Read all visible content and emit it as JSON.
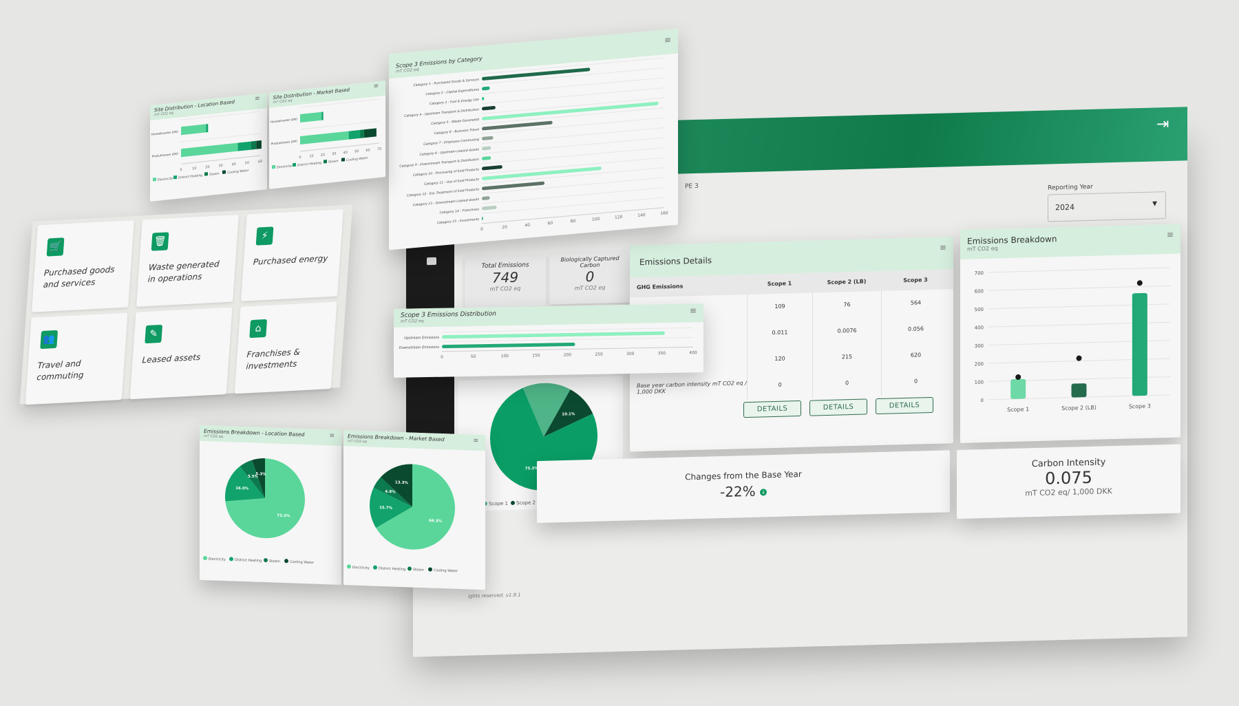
{
  "colors": {
    "accent": "#0e9a62",
    "light": "#5ad69b",
    "dark": "#1f6a4a",
    "header": "#d6eedd"
  },
  "header": {
    "exit_icon": "logout-icon",
    "tab_fragment": "PE 3"
  },
  "reporting_year": {
    "label": "Reporting Year",
    "value": "2024"
  },
  "kpis": {
    "total": {
      "label": "Total Emissions",
      "value": "749",
      "unit": "mT CO2 eq"
    },
    "bio": {
      "label": "Biologically Captured Carbon",
      "value": "0",
      "unit": "mT CO2 eq"
    }
  },
  "details": {
    "title": "Emissions Details",
    "row_header": "GHG Emissions",
    "columns": [
      "Scope 1",
      "Scope 2 (LB)",
      "Scope 3"
    ],
    "row_fragments": [
      "s",
      "",
      "sions",
      "Base year carbon intensity mT CO2 eq / 1,000 DKK"
    ],
    "rows": [
      [
        "109",
        "76",
        "564"
      ],
      [
        "0.011",
        "0.0076",
        "0.056"
      ],
      [
        "120",
        "215",
        "620"
      ],
      [
        "0",
        "0",
        "0"
      ]
    ],
    "button": "DETAILS"
  },
  "base_change": {
    "label": "Changes from the Base Year",
    "value": "-22%",
    "icon": "arrow-down-circle-icon"
  },
  "intensity": {
    "label": "Carbon Intensity",
    "value": "0.075",
    "unit": "mT CO2 eq/ 1,000 DKK"
  },
  "footer": "ights reserved. v1.9.1",
  "tiles": [
    {
      "label": "Purchased goods and services",
      "icon": "cart-icon",
      "glyph": "🛒"
    },
    {
      "label": "Waste generated in operations",
      "icon": "trash-icon",
      "glyph": "🗑"
    },
    {
      "label": "Purchased energy",
      "icon": "lightning-icon",
      "glyph": "⚡"
    },
    {
      "label": "Travel and commuting",
      "icon": "people-icon",
      "glyph": "👥"
    },
    {
      "label": "Leased assets",
      "icon": "edit-icon",
      "glyph": "✎"
    },
    {
      "label": "Franchises & investments",
      "icon": "buildings-icon",
      "glyph": "⌂"
    }
  ],
  "chart_data": [
    {
      "id": "breakdown",
      "type": "bar",
      "title": "Emissions Breakdown",
      "subtitle": "mT CO2 eq",
      "categories": [
        "Scope 1",
        "Scope 2 (LB)",
        "Scope 3"
      ],
      "values": [
        109,
        76,
        564
      ],
      "markers": [
        120,
        215,
        620
      ],
      "ylim": [
        0,
        700
      ],
      "yticks": [
        0,
        100,
        200,
        300,
        400,
        500,
        600,
        700
      ],
      "grid": true,
      "bar_colors": [
        "#6dd9a6",
        "#256b4d",
        "#23a878"
      ]
    },
    {
      "id": "scope3cat",
      "type": "bar",
      "orientation": "horizontal",
      "title": "Scope 3 Emissions by Category",
      "subtitle": "mT CO2 eq",
      "categories": [
        "Category 1 - Purchased Goods & Services",
        "Category 2 - Capital Expenditures",
        "Category 3 - Fuel & Energy Use",
        "Category 4 - Upstream Transport & Distribution",
        "Category 5 - Waste Generated",
        "Category 6 - Business Travel",
        "Category 7 - Employee Commuting",
        "Category 8 - Upstream Leased Assets",
        "Category 9 - Downstream Transport & Distribution",
        "Category 10 - Processing of Sold Products",
        "Category 11 - Use of Sold Products",
        "Category 12 - EoL Treatment of Sold Products",
        "Category 13 - Downstream Leased Assets",
        "Category 14 - Franchises",
        "Category 15 - Investments"
      ],
      "values": [
        95,
        7,
        2,
        12,
        155,
        62,
        10,
        8,
        8,
        18,
        105,
        55,
        7,
        13,
        1
      ],
      "xlim": [
        0,
        160
      ],
      "xticks": [
        0,
        20,
        40,
        60,
        80,
        100,
        120,
        140,
        160
      ],
      "bar_colors": [
        "#1f6a4a",
        "#23a878",
        "#3cc48a",
        "#173f2f",
        "#8ef0c0",
        "#5d7266",
        "#8fa396",
        "#b8cfc1",
        "#5ad69b",
        "#173f2f",
        "#8ef0c0",
        "#5d7266",
        "#8fa396",
        "#b8cfc1",
        "#23a878"
      ]
    },
    {
      "id": "scope3dist",
      "type": "bar",
      "orientation": "horizontal",
      "title": "Scope 3 Emissions Distribution",
      "subtitle": "mT CO2 eq",
      "categories": [
        "Upstream Emissions",
        "Downstream Emissions"
      ],
      "values": [
        355,
        212
      ],
      "xlim": [
        0,
        400
      ],
      "xticks": [
        0,
        50,
        100,
        150,
        200,
        250,
        300,
        350,
        400
      ],
      "bar_colors": [
        "#8ef0c0",
        "#23a878"
      ]
    },
    {
      "id": "siteloc",
      "type": "bar",
      "orientation": "horizontal",
      "stacked": true,
      "title": "Site Distribution - Location Based",
      "subtitle": "mT CO2 eq",
      "categories": [
        "Hovedkvarter (DK)",
        "Produktionen (DK)"
      ],
      "series": [
        {
          "name": "Electricity",
          "values": [
            19,
            43
          ]
        },
        {
          "name": "District Heating",
          "values": [
            1.5,
            10
          ]
        },
        {
          "name": "Steam",
          "values": [
            0,
            4
          ]
        },
        {
          "name": "Cooling Water",
          "values": [
            0,
            4
          ]
        }
      ],
      "xlim": [
        0,
        60
      ],
      "xticks": [
        0,
        10,
        20,
        30,
        40,
        50,
        60
      ]
    },
    {
      "id": "sitemkt",
      "type": "bar",
      "orientation": "horizontal",
      "stacked": true,
      "title": "Site Distribution - Market Based",
      "subtitle": "mT CO2 eq",
      "categories": [
        "Hovedkvarter (DK)",
        "Produktionen (DK)"
      ],
      "series": [
        {
          "name": "Electricity",
          "values": [
            19,
            43
          ]
        },
        {
          "name": "District Heating",
          "values": [
            1.5,
            10
          ]
        },
        {
          "name": "Steam",
          "values": [
            0,
            3.5
          ]
        },
        {
          "name": "Cooling Water",
          "values": [
            0,
            11
          ]
        }
      ],
      "xlim": [
        0,
        70
      ],
      "xticks": [
        0,
        10,
        20,
        30,
        40,
        50,
        60,
        70
      ]
    },
    {
      "id": "pieloc",
      "type": "pie",
      "title": "Emissions Breakdown - Location Based",
      "subtitle": "mT CO2 eq",
      "labels": [
        "Electricity",
        "District Heating",
        "Steam",
        "Cooling Water"
      ],
      "values": [
        73.3,
        16.0,
        5.5,
        5.3
      ],
      "data_labels": [
        "73.3%",
        "16.0%",
        "5.5%",
        "5.3%"
      ]
    },
    {
      "id": "piemkt",
      "type": "pie",
      "title": "Emissions Breakdown - Market Based",
      "subtitle": "mT CO2 eq",
      "labels": [
        "Electricity",
        "District Heating",
        "Steam",
        "Cooling Water"
      ],
      "values": [
        66.3,
        15.7,
        4.8,
        13.3
      ],
      "data_labels": [
        "66.3%",
        "15.7%",
        "4.8%",
        "13.3%"
      ]
    },
    {
      "id": "piescope",
      "type": "pie",
      "labels": [
        "Scope 1",
        "Scope 2",
        "Scope 3"
      ],
      "values": [
        14.6,
        10.1,
        75.3
      ],
      "data_labels": [
        "",
        "10.1%",
        "75.3%"
      ],
      "colors": [
        "#4fb487",
        "#0b4a30",
        "#0a9e66"
      ]
    }
  ],
  "pie_colors": [
    "#5ad69b",
    "#11a36b",
    "#0b7a4c",
    "#0a4a2f"
  ]
}
